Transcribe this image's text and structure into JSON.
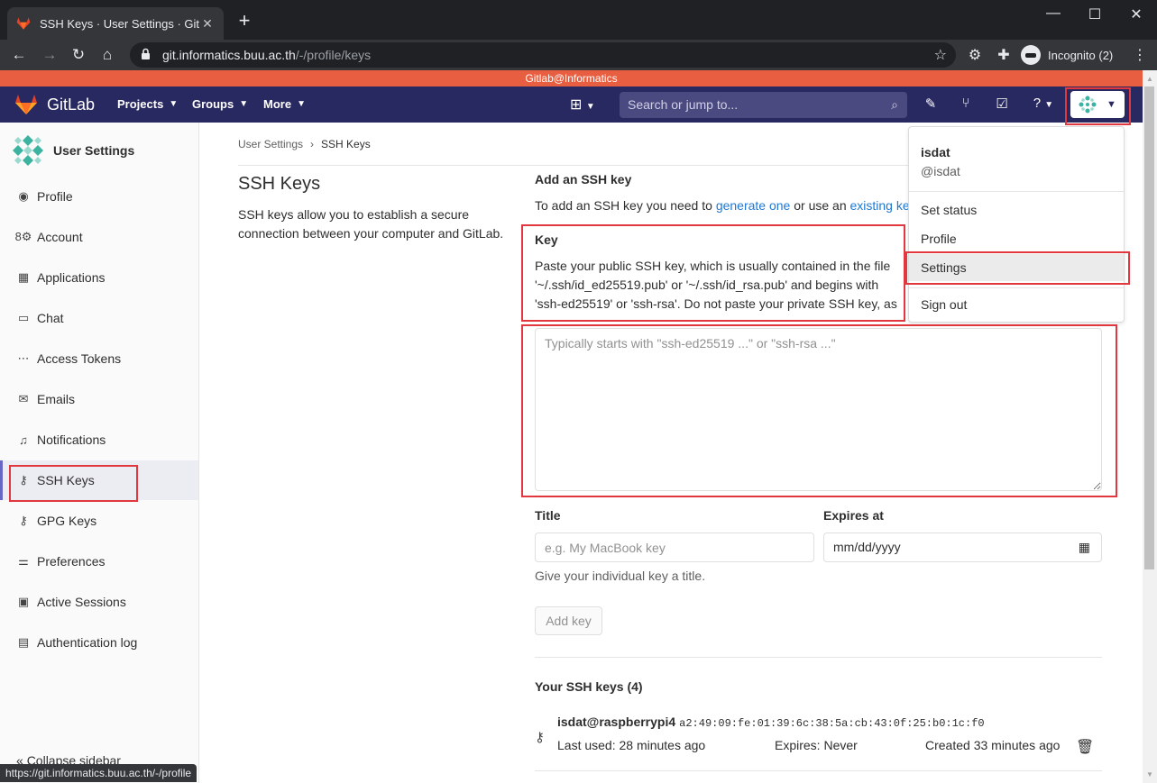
{
  "browser": {
    "tab_title": "SSH Keys · User Settings · GitLab",
    "url_host": "git.informatics.buu.ac.th",
    "url_path": "/-/profile/keys",
    "incognito_label": "Incognito (2)",
    "status_url": "https://git.informatics.buu.ac.th/-/profile"
  },
  "banner": {
    "text": "Gitlab@Informatics"
  },
  "header": {
    "brand": "GitLab",
    "nav": [
      {
        "label": "Projects"
      },
      {
        "label": "Groups"
      },
      {
        "label": "More"
      }
    ],
    "search_placeholder": "Search or jump to..."
  },
  "sidebar": {
    "title": "User Settings",
    "items": [
      {
        "label": "Profile",
        "icon": "profile-icon"
      },
      {
        "label": "Account",
        "icon": "account-icon"
      },
      {
        "label": "Applications",
        "icon": "applications-icon"
      },
      {
        "label": "Chat",
        "icon": "chat-icon"
      },
      {
        "label": "Access Tokens",
        "icon": "token-icon"
      },
      {
        "label": "Emails",
        "icon": "mail-icon"
      },
      {
        "label": "Notifications",
        "icon": "bell-icon"
      },
      {
        "label": "SSH Keys",
        "icon": "key-icon",
        "active": true
      },
      {
        "label": "GPG Keys",
        "icon": "key-icon"
      },
      {
        "label": "Preferences",
        "icon": "preferences-icon"
      },
      {
        "label": "Active Sessions",
        "icon": "monitor-icon"
      },
      {
        "label": "Authentication log",
        "icon": "log-icon"
      }
    ],
    "collapse_label": "Collapse sidebar"
  },
  "main": {
    "breadcrumb": [
      "User Settings",
      "SSH Keys"
    ],
    "title": "SSH Keys",
    "description": "SSH keys allow you to establish a secure connection between your computer and GitLab.",
    "add_title": "Add an SSH key",
    "intro_prefix": "To add an SSH key you need to ",
    "intro_link1": "generate one",
    "intro_middle": " or use an ",
    "intro_link2": "existing key",
    "key_label": "Key",
    "key_help": "Paste your public SSH key, which is usually contained in the file '~/.ssh/id_ed25519.pub' or '~/.ssh/id_rsa.pub' and begins with 'ssh-ed25519' or 'ssh-rsa'. Do not paste your private SSH key, as that can compromise your identity.",
    "key_placeholder": "Typically starts with \"ssh-ed25519 ...\" or \"ssh-rsa ...\"",
    "title_label": "Title",
    "title_placeholder": "e.g. My MacBook key",
    "title_help": "Give your individual key a title.",
    "expires_label": "Expires at",
    "expires_placeholder": "mm/dd/yyyy",
    "add_button": "Add key",
    "your_keys_title": "Your SSH keys (4)",
    "keys": [
      {
        "name": "isdat@raspberrypi4",
        "fingerprint": "a2:49:09:fe:01:39:6c:38:5a:cb:43:0f:25:b0:1c:f0",
        "last_used": "Last used: 28 minutes ago",
        "expires": "Expires: Never",
        "created": "Created 33 minutes ago"
      }
    ]
  },
  "user_menu": {
    "name": "isdat",
    "handle": "@isdat",
    "items": [
      "Set status",
      "Profile",
      "Settings",
      "Sign out"
    ]
  },
  "colors": {
    "header_bg": "#292961",
    "banner_bg": "#e75e40",
    "highlight": "#e0383e",
    "link": "#1f78d1"
  }
}
